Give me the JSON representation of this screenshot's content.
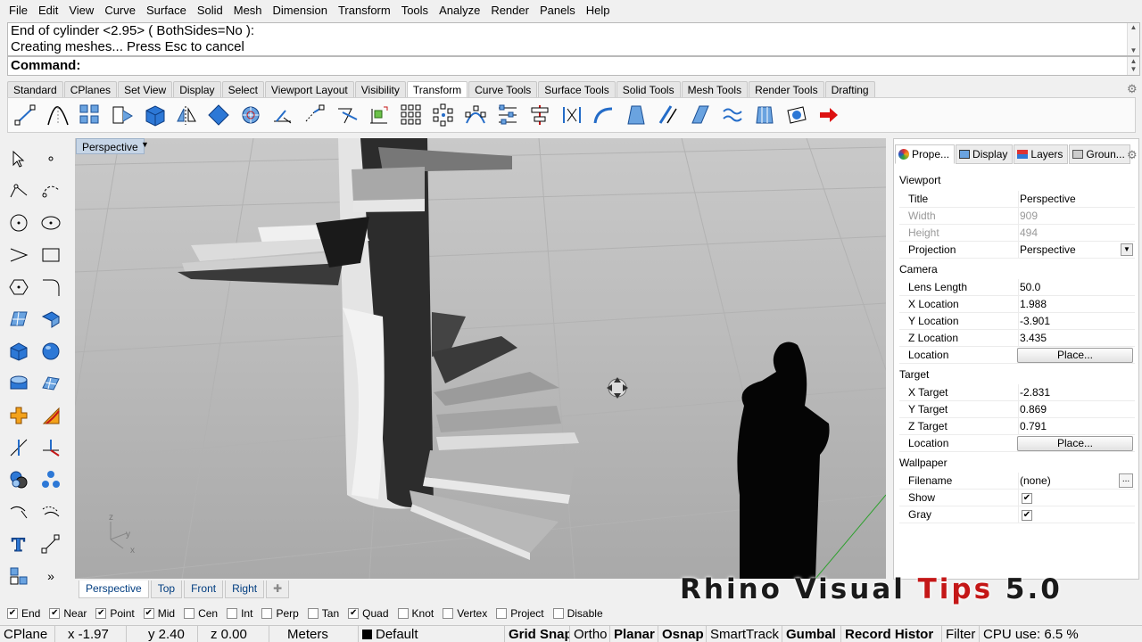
{
  "menu": [
    "File",
    "Edit",
    "View",
    "Curve",
    "Surface",
    "Solid",
    "Mesh",
    "Dimension",
    "Transform",
    "Tools",
    "Analyze",
    "Render",
    "Panels",
    "Help"
  ],
  "command": {
    "history_line1": "End of cylinder <2.95> ( BothSides=No ):",
    "history_line2": "Creating meshes... Press Esc to cancel",
    "prompt": "Command:"
  },
  "toolbar_tabs": [
    "Standard",
    "CPlanes",
    "Set View",
    "Display",
    "Select",
    "Viewport Layout",
    "Visibility",
    "Transform",
    "Curve Tools",
    "Surface Tools",
    "Solid Tools",
    "Mesh Tools",
    "Render Tools",
    "Drafting"
  ],
  "active_toolbar_tab": "Transform",
  "viewport": {
    "name": "Perspective",
    "tabs": [
      "Perspective",
      "Top",
      "Front",
      "Right"
    ],
    "axis": {
      "z": "z",
      "y": "y",
      "x": "x"
    }
  },
  "panel_tabs": [
    {
      "label": "Prope...",
      "icon": "properties-icon"
    },
    {
      "label": "Display",
      "icon": "display-icon"
    },
    {
      "label": "Layers",
      "icon": "layers-icon"
    },
    {
      "label": "Groun...",
      "icon": "ground-plane-icon"
    }
  ],
  "properties": {
    "viewport_section": "Viewport",
    "title_label": "Title",
    "title_value": "Perspective",
    "width_label": "Width",
    "width_value": "909",
    "height_label": "Height",
    "height_value": "494",
    "projection_label": "Projection",
    "projection_value": "Perspective",
    "camera_section": "Camera",
    "lens_label": "Lens Length",
    "lens_value": "50.0",
    "xloc_label": "X Location",
    "xloc_value": "1.988",
    "yloc_label": "Y Location",
    "yloc_value": "-3.901",
    "zloc_label": "Z Location",
    "zloc_value": "3.435",
    "camloc_label": "Location",
    "camloc_button": "Place...",
    "target_section": "Target",
    "xt_label": "X Target",
    "xt_value": "-2.831",
    "yt_label": "Y Target",
    "yt_value": "0.869",
    "zt_label": "Z Target",
    "zt_value": "0.791",
    "tloc_label": "Location",
    "tloc_button": "Place...",
    "wallpaper_section": "Wallpaper",
    "filename_label": "Filename",
    "filename_value": "(none)",
    "filename_button": "...",
    "show_label": "Show",
    "gray_label": "Gray"
  },
  "osnaps": [
    {
      "label": "End",
      "checked": true
    },
    {
      "label": "Near",
      "checked": true
    },
    {
      "label": "Point",
      "checked": true
    },
    {
      "label": "Mid",
      "checked": true
    },
    {
      "label": "Cen",
      "checked": false
    },
    {
      "label": "Int",
      "checked": false
    },
    {
      "label": "Perp",
      "checked": false
    },
    {
      "label": "Tan",
      "checked": false
    },
    {
      "label": "Quad",
      "checked": true
    },
    {
      "label": "Knot",
      "checked": false
    },
    {
      "label": "Vertex",
      "checked": false
    },
    {
      "label": "Project",
      "checked": false
    },
    {
      "label": "Disable",
      "checked": false
    }
  ],
  "status": {
    "cplane": "CPlane",
    "x": "x -1.97",
    "y": "y 2.40",
    "z": "z 0.00",
    "units": "Meters",
    "layer": "Default",
    "grid_snap": "Grid Snap",
    "ortho": "Ortho",
    "planar": "Planar",
    "osnap": "Osnap",
    "smarttrack": "SmartTrack",
    "gumball": "Gumbal",
    "record_history": "Record Histor",
    "filter": "Filter",
    "cpu": "CPU use: 6.5 %"
  },
  "watermark": {
    "part1": "Rhino Visual ",
    "part2": "Tips",
    "part3": " 5.0"
  },
  "colors": {
    "accent_red": "#c41717",
    "viewport_label_bg": "#c6d5e6"
  }
}
